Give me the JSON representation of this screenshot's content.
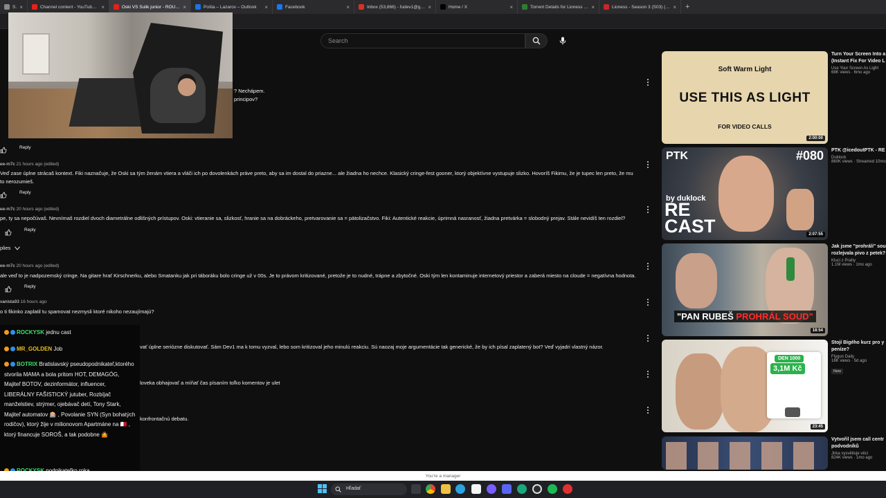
{
  "browser": {
    "tabs": [
      {
        "title": "Shot ...",
        "color": "#888888"
      },
      {
        "title": "Channel content - YouTube Studio",
        "color": "#e62117"
      },
      {
        "title": "Oski VS Sulik junior - ROUND 2",
        "color": "#e62117",
        "active": true
      },
      {
        "title": "Pošta – Lazarov – Outlook",
        "color": "#1a73e8"
      },
      {
        "title": "Facebook",
        "color": "#1877f2"
      },
      {
        "title": "Inbox (53,866) - fudev1@gmail.com",
        "color": "#d93025"
      },
      {
        "title": "Home / X",
        "color": "#000000"
      },
      {
        "title": "Torrent Details for Lioness 2023",
        "color": "#2e7d32"
      },
      {
        "title": "Lioness - Season 3 (S03) (2025)",
        "color": "#c62828"
      }
    ],
    "close_glyph": "×",
    "new_tab_glyph": "+"
  },
  "header": {
    "search_placeholder": "Search",
    "search_icon": "search-icon",
    "mic_icon": "mic-icon"
  },
  "comments": [
    {
      "meta_user": "",
      "meta_time": "",
      "text_lines": [
        "? Nechápem.",
        "principov?"
      ],
      "reply": "Reply"
    },
    {
      "meta_user": "ee-m7c",
      "meta_time": "21 hours ago (edited)",
      "text_lines": [
        "Veď zase úplne strácaš kontext. Fiki naznačuje, že Oski sa tým ženám vtiera a vláči ich po dovolenkách práve preto, aby sa im dostal do priazne... ale žiadna ho nechce. Klasický cringe-fest gooner, ktorý objektívne vystupuje slizko. Hovoríš Fikimu, že je tupec len preto, že mu",
        "to nerozumieš."
      ],
      "reply": "Reply"
    },
    {
      "meta_user": "ee-m7c",
      "meta_time": "20 hours ago (edited)",
      "text_lines": [
        "pe, ty sa nepočúvaš. Nevnímaš rozdiel dvoch diametrálne odlišných prístupov. Oski: vtieranie sa, slizkosť, hranie sa na dobráckeho, pretvarovanie sa = pätolizačstvo. Fiki: Autentické reakcie, úprimná nasranosť, žiadna pretvárka = slobodný prejav. Stále nevidíš ten rozdiel?"
      ],
      "reply": "Reply"
    },
    {
      "meta_user": "ee-m7c",
      "meta_time": "20 hours ago (edited)",
      "text_lines": [
        "ale veď to je nadpozemský cringe. Na gitare hrať Kirschnerku, alebo Smatanku jak pri táboráku bolo cringe už v 00s. Je to právom kritizované, pretože je to nudné, trápne a zbytočné. Oski tým len kontaminuje internetový priestor a zaberá miesto na cloude = negatívna hodnota."
      ],
      "reply": "Reply"
    },
    {
      "meta_user": "vanista93",
      "meta_time": "16 hours ago",
      "text_lines": [
        "o ti fikinko zaplatil tu spamovat nezmysli ktoré nikoho nezaujímajú?"
      ],
      "reply": "Reply"
    },
    {
      "meta_user": "",
      "meta_time": "",
      "text_lines": [
        "vať úplne seriózne diskutovať. Sám Dev1 ma k tomu vyzval, lebo som kritizoval jeho minulú reakciu. Sú naozaj moje argumentácie tak generické, že by ich písal zaplatený bot? Veď vyjadri vlastný názor."
      ],
      "reply": ""
    },
    {
      "meta_user": "",
      "meta_time": "",
      "text_lines": [
        "loveka obhajovať a míňať čas písaním toľko komentov je ulet"
      ],
      "reply": ""
    },
    {
      "meta_user": "",
      "meta_time": "",
      "text_lines": [
        "konfrontačnú debatu."
      ],
      "reply": ""
    }
  ],
  "replies_toggle": "plies",
  "sidebar_videos": [
    {
      "thumb_top": "Soft Warm Light",
      "thumb_big": "USE THIS AS LIGHT",
      "thumb_bottom": "FOR VIDEO CALLS",
      "duration": "2:00:00",
      "title_lines": [
        "Turn Your Screen Into a",
        "(Instant Fix For Video L"
      ],
      "channel": "Use Your Screen As Light",
      "stats": "68K views · 6mo ago",
      "badge": ""
    },
    {
      "thumb_ptk": "PTK",
      "thumb_num": "#080",
      "thumb_by": "by duklock",
      "thumb_re": "RE",
      "thumb_cast": "CAST",
      "duration": "2:07:55",
      "title_lines": [
        "PTK @icedoutPTK - RE"
      ],
      "channel": "Duklock",
      "stats": "860K views · Streamed 10mo a",
      "badge": ""
    },
    {
      "thumb_text_a": "\"PAN RUBEŠ ",
      "thumb_text_b": "PROHRÁL SOUD\"",
      "duration": "18:54",
      "title_lines": [
        "Jak jsme \"prohráli\" sou",
        "rozlejvala pivo z petek?"
      ],
      "channel": "Kluci z Prahy",
      "stats": "1.1M views · 1mo ago",
      "badge": ""
    },
    {
      "thumb_den": "DEN 1000",
      "thumb_amt": "3,1M Kč",
      "duration": "23:45",
      "title_lines": [
        "Stojí Bigého kurz pro y",
        "peníze?"
      ],
      "channel": "Flygun Daily",
      "stats": "16K views · 5d ago",
      "badge": "New"
    },
    {
      "duration": "",
      "title_lines": [
        "Vytvořil jsem call centr",
        "podvodníků"
      ],
      "channel": "Jirka vysvětluje věci",
      "stats": "824K views · 1mo ago",
      "badge": ""
    }
  ],
  "chat": [
    {
      "name": "ROCKYSK",
      "name_color": "#3fe06a",
      "text": "jednu cast"
    },
    {
      "name": "MR_GOLDEN",
      "name_color": "#e8c020",
      "text": "Job"
    },
    {
      "name": "BOTRIX",
      "name_color": "#3fe06a",
      "text": "Bratislavský pseudopodnikateľ,ktorého stvorila MAMA a bola pritom HOT, DEMAGÓG, Majiteľ BOTOV, dezinformátor, influencer, LIBERÁLNY FAŠISTICKÝ jutuber, Rozbíjač manželstiev, strýmer, ojebávač detí, Tony Stark, Majiteľ automatov 🎰 , Povolanie SYN (Syn bohatých rodičov), ktorý žije v milionovom Apartmáne na 🇲🇹 , ktorý financuje SOROŠ, a tak podobne 🤷"
    },
    {
      "name": "ROCKYSK",
      "name_color": "#3fe06a",
      "text": "podnikateľko roka"
    },
    {
      "name": "ROCKYSK",
      "name_color": "#3fe06a",
      "text": ""
    }
  ],
  "manager_text": "You're a manager",
  "taskbar": {
    "search_label": "Hľadať"
  }
}
